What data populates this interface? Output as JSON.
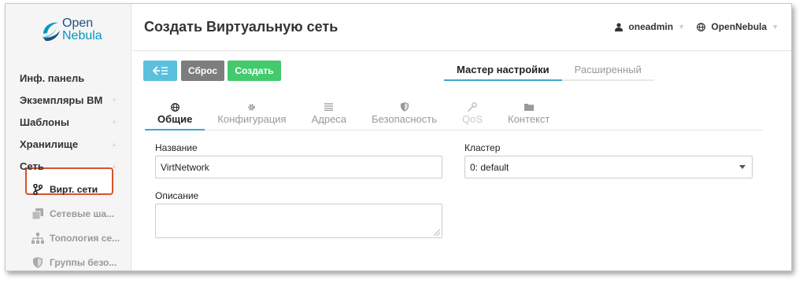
{
  "brand": {
    "line1": "Open",
    "line2": "Nebula"
  },
  "sidebar": {
    "items": [
      {
        "label": "Инф. панель"
      },
      {
        "label": "Экземпляры ВМ"
      },
      {
        "label": "Шаблоны"
      },
      {
        "label": "Хранилище"
      },
      {
        "label": "Сеть"
      }
    ],
    "sub_items": [
      {
        "label": "Вирт. сети",
        "icon": "code-fork-icon"
      },
      {
        "label": "Сетевые ша...",
        "icon": "copy-icon"
      },
      {
        "label": "Топология се...",
        "icon": "sitemap-icon"
      },
      {
        "label": "Группы безо...",
        "icon": "shield-icon"
      }
    ]
  },
  "header": {
    "title": "Создать Виртуальную сеть",
    "user": "oneadmin",
    "zone": "OpenNebula"
  },
  "toolbar": {
    "reset_label": "Сброс",
    "create_label": "Создать"
  },
  "mode_tabs": [
    {
      "label": "Мастер настройки"
    },
    {
      "label": "Расширенный"
    }
  ],
  "section_tabs": [
    {
      "label": "Общие",
      "icon": "globe-icon"
    },
    {
      "label": "Конфигурация",
      "icon": "gear-icon"
    },
    {
      "label": "Адреса",
      "icon": "list-icon"
    },
    {
      "label": "Безопасность",
      "icon": "shield-icon"
    },
    {
      "label": "QoS",
      "icon": "wrench-icon"
    },
    {
      "label": "Контекст",
      "icon": "folder-icon"
    }
  ],
  "form": {
    "name_label": "Название",
    "name_value": "VirtNetwork",
    "description_label": "Описание",
    "description_value": "",
    "cluster_label": "Кластер",
    "cluster_value": "0: default"
  },
  "colors": {
    "accent": "#3ea7cf",
    "back_button": "#5bc0de",
    "reset_button": "#7d7d7d",
    "create_button": "#43ca6c",
    "highlight": "#d9532c"
  }
}
